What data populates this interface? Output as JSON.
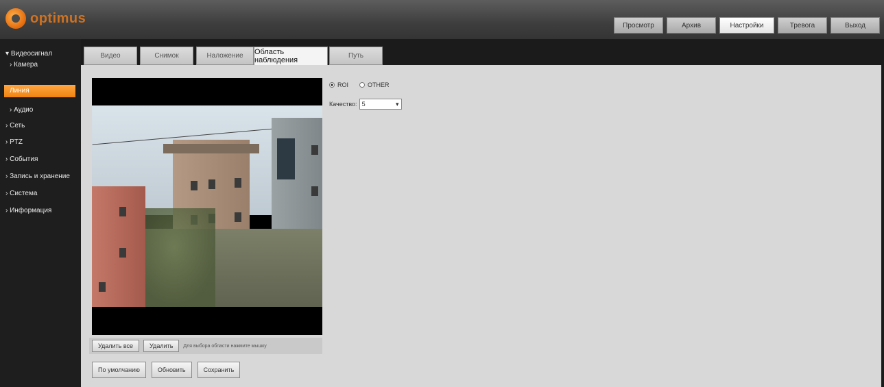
{
  "app": {
    "logo_text": "optimus"
  },
  "topnav": {
    "items": [
      {
        "label": "Просмотр"
      },
      {
        "label": "Архив"
      },
      {
        "label": "Настройки",
        "active": true
      },
      {
        "label": "Тревога"
      },
      {
        "label": "Выход"
      }
    ]
  },
  "sidebar": {
    "items": [
      {
        "label": "Видеосигнал"
      },
      {
        "label": "Камера"
      },
      {
        "label": "Линия",
        "active": true
      },
      {
        "label": "Аудио"
      },
      {
        "label": "Сеть"
      },
      {
        "label": "PTZ"
      },
      {
        "label": "События"
      },
      {
        "label": "Запись и хранение"
      },
      {
        "label": "Система"
      },
      {
        "label": "Информация"
      }
    ]
  },
  "tabs": [
    {
      "label": "Видео"
    },
    {
      "label": "Снимок"
    },
    {
      "label": "Наложение"
    },
    {
      "label": "Область наблюдения",
      "active": true
    },
    {
      "label": "Путь"
    }
  ],
  "options": {
    "radio1_label": "ROI",
    "radio2_label": "OTHER",
    "quality_label": "Качество:",
    "quality_value": "5"
  },
  "video_bar": {
    "btn1": "Удалить все",
    "btn2": "Удалить",
    "hint": "Для выбора области нажмите мышку"
  },
  "bottom_bar": {
    "default_label": "По умолчанию",
    "refresh_label": "Обновить",
    "save_label": "Сохранить"
  }
}
